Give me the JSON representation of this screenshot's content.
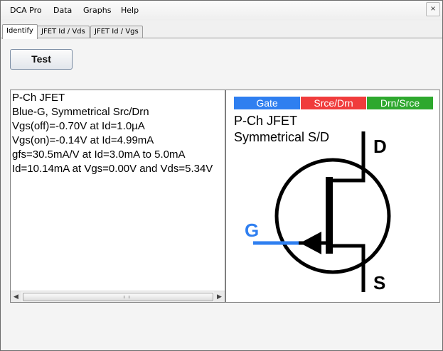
{
  "menubar": {
    "items": [
      "DCA Pro",
      "Data",
      "Graphs",
      "Help"
    ],
    "close_glyph": "×"
  },
  "tabs": [
    {
      "label": "Identify",
      "active": true
    },
    {
      "label": "JFET Id / Vds",
      "active": false
    },
    {
      "label": "JFET Id / Vgs",
      "active": false
    }
  ],
  "test_button": {
    "label": "Test"
  },
  "results": {
    "lines": [
      "P-Ch JFET",
      "Blue-G, Symmetrical Src/Drn",
      "Vgs(off)=-0.70V at Id=1.0µA",
      "Vgs(on)=-0.14V at Id=4.99mA",
      "gfs=30.5mA/V at Id=3.0mA to 5.0mA",
      "Id=10.14mA at Vgs=0.00V and Vds=5.34V"
    ]
  },
  "scrollbar": {
    "left_arrow": "◀",
    "right_arrow": "▶"
  },
  "diagram": {
    "pins": [
      {
        "label": "Gate",
        "color": "#2f7ff0"
      },
      {
        "label": "Srce/Drn",
        "color": "#f03c3c"
      },
      {
        "label": "Drn/Srce",
        "color": "#2ea82e"
      }
    ],
    "title": "P-Ch JFET",
    "subtitle": "Symmetrical S/D",
    "label_d": "D",
    "label_g": "G",
    "label_s": "S",
    "gate_color": "#2f7ff0"
  }
}
